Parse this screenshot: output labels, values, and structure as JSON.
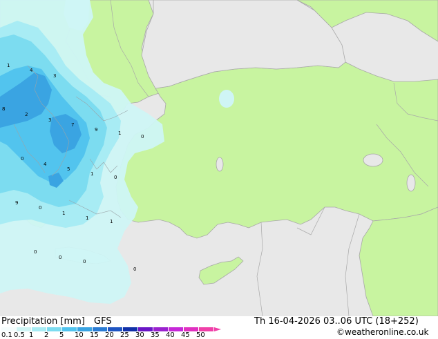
{
  "map": {
    "colors": {
      "sea": "#e8e8e8",
      "land": "#c8f4a0",
      "border": "#a8a8a8"
    },
    "contour_labels": [
      "1",
      "4",
      "3",
      "8",
      "2",
      "3",
      "7",
      "9",
      "1",
      "0",
      "0",
      "4",
      "5",
      "1",
      "0",
      "9",
      "0",
      "1",
      "1",
      "1",
      "0",
      "0",
      "0",
      "0"
    ]
  },
  "footer": {
    "title": "Precipitation [mm]",
    "model": "GFS",
    "datetime": "Th 16-04-2026 03..06 UTC (18+252)",
    "copyright": "©weatheronline.co.uk",
    "scale_values": [
      "0.1",
      "0.5",
      "1",
      "2",
      "5",
      "10",
      "15",
      "20",
      "25",
      "30",
      "35",
      "40",
      "45",
      "50"
    ],
    "scale_colors": [
      "#f5fdfd",
      "#cff5f5",
      "#a8ecf4",
      "#7cdcf0",
      "#52c4ee",
      "#3aa4e2",
      "#2a7cd4",
      "#1f55c2",
      "#1130a8",
      "#6a16c6",
      "#9a22ce",
      "#c628d8",
      "#e030c0",
      "#f040a8"
    ]
  }
}
